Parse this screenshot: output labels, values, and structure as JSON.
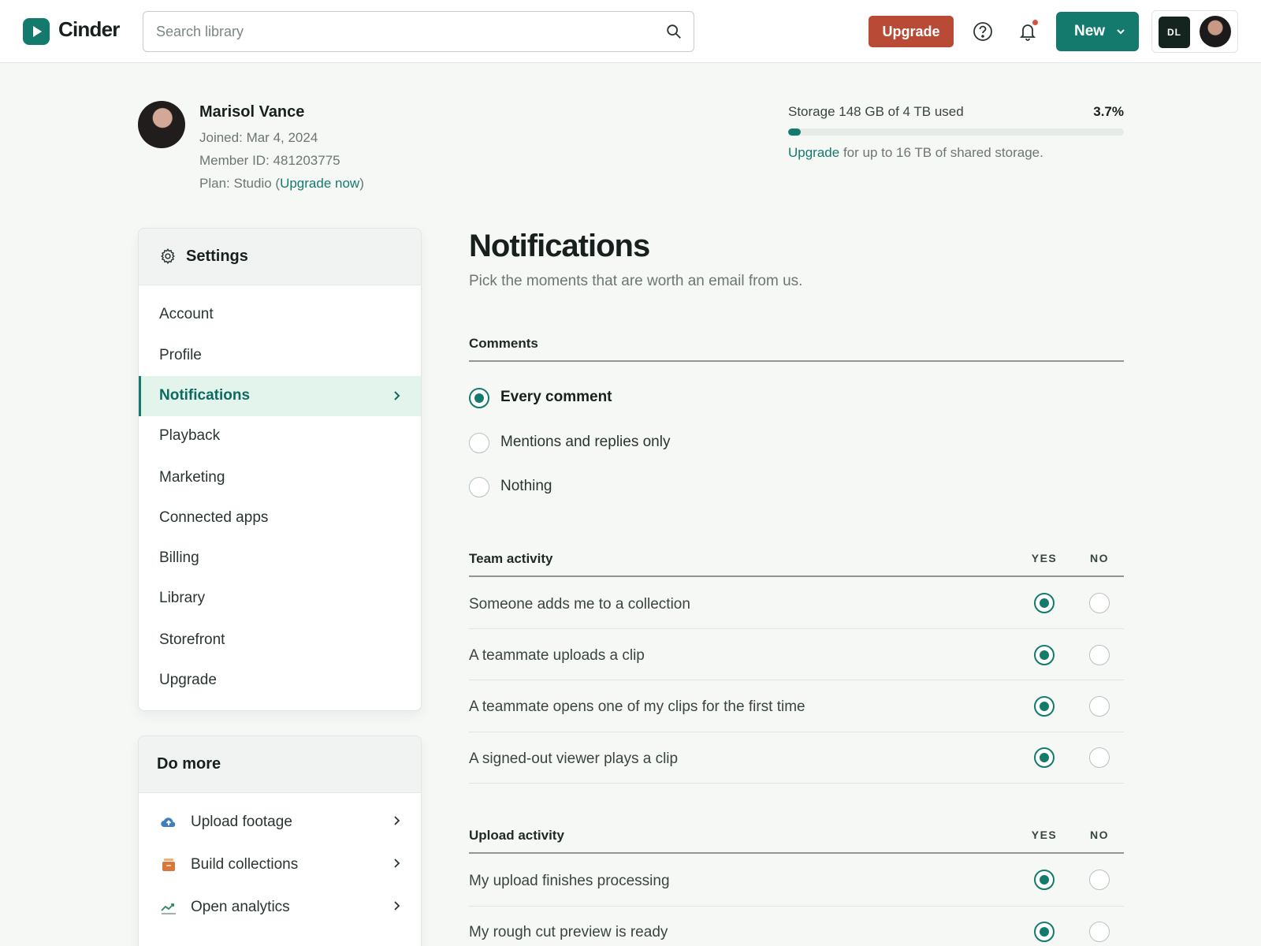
{
  "app": {
    "name": "Cinder"
  },
  "header": {
    "search_placeholder": "Search library",
    "upgrade_label": "Upgrade",
    "new_label": "New",
    "account_initials": "DL",
    "colors": {
      "brand": "#157a6e",
      "upgrade": "#b94a36"
    }
  },
  "profile": {
    "name": "Marisol Vance",
    "joined_label": "Joined:",
    "joined": "Mar 4, 2024",
    "member_label": "Member ID:",
    "member_id": "481203775",
    "plan_label": "Plan:",
    "plan": "Studio",
    "plan_upgrade": "Upgrade now"
  },
  "storage": {
    "label": "Storage 148 GB of 4 TB used",
    "percent_text": "3.7%",
    "percent_value": 3.7,
    "note_link": "Upgrade",
    "note_rest": " for up to 16 TB of shared storage."
  },
  "settings": {
    "title": "Settings",
    "items": [
      {
        "label": "Account",
        "active": false
      },
      {
        "label": "Profile",
        "active": false
      },
      {
        "label": "Notifications",
        "active": true
      },
      {
        "label": "Playback",
        "active": false
      },
      {
        "label": "Marketing",
        "active": false
      },
      {
        "label": "Connected apps",
        "active": false
      },
      {
        "label": "Billing",
        "active": false
      },
      {
        "label": "Library",
        "active": false
      },
      {
        "label": "Storefront",
        "active": false
      },
      {
        "label": "Upgrade",
        "active": false
      }
    ]
  },
  "do_more": {
    "title": "Do more",
    "items": [
      {
        "label": "Upload footage",
        "icon": "cloud-upload-icon"
      },
      {
        "label": "Build collections",
        "icon": "collections-icon"
      },
      {
        "label": "Open analytics",
        "icon": "analytics-icon"
      }
    ]
  },
  "main": {
    "title": "Notifications",
    "subtitle": "Pick the moments that are worth an email from us.",
    "comments": {
      "title": "Comments",
      "options": [
        {
          "label": "Every comment",
          "selected": true
        },
        {
          "label": "Mentions and replies only",
          "selected": false
        },
        {
          "label": "Nothing",
          "selected": false
        }
      ]
    },
    "team_activity": {
      "title": "Team activity",
      "yes": "YES",
      "no": "NO",
      "rows": [
        {
          "label": "Someone adds me to a collection",
          "value": "yes"
        },
        {
          "label": "A teammate uploads a clip",
          "value": "yes"
        },
        {
          "label": "A teammate opens one of my clips for the first time",
          "value": "yes"
        },
        {
          "label": "A signed-out viewer plays a clip",
          "value": "yes"
        }
      ]
    },
    "upload_activity": {
      "title": "Upload activity",
      "yes": "YES",
      "no": "NO",
      "rows": [
        {
          "label": "My upload finishes processing",
          "value": "yes"
        },
        {
          "label": "My rough cut preview is ready",
          "value": "yes"
        }
      ]
    }
  }
}
